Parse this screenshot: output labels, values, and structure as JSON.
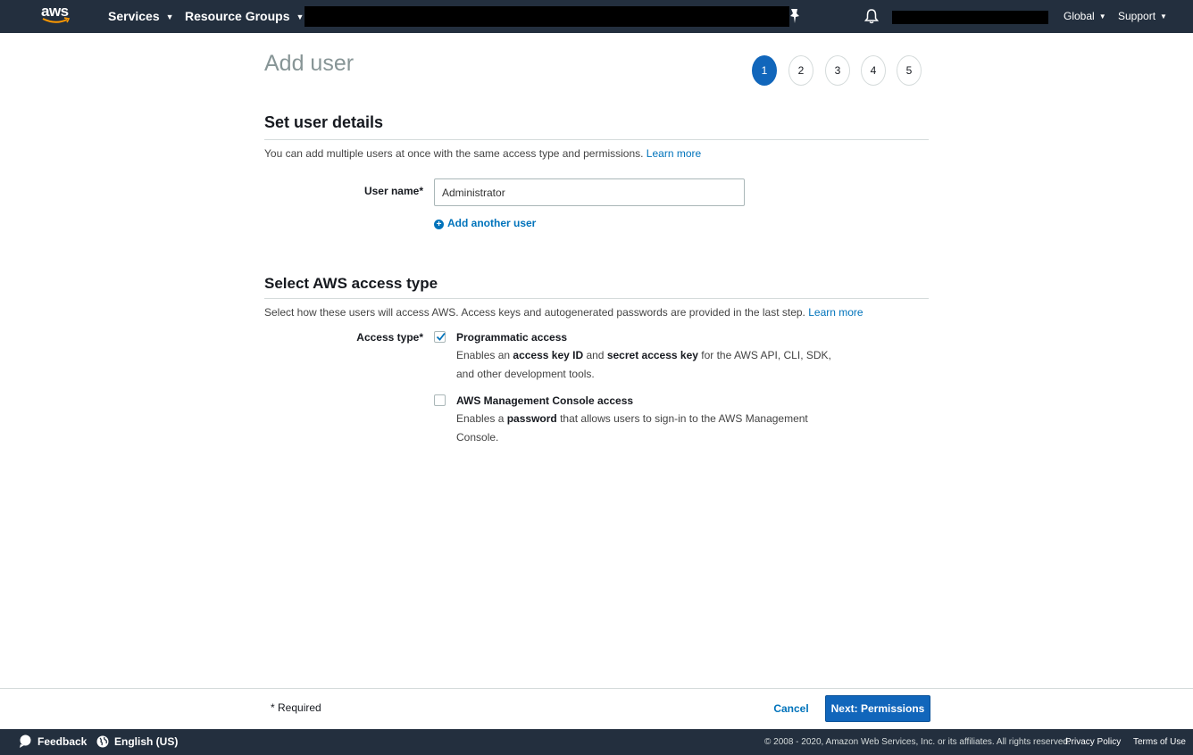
{
  "topnav": {
    "logo_text": "aws",
    "services_label": "Services",
    "resource_groups_label": "Resource Groups",
    "region_label": "Global",
    "support_label": "Support"
  },
  "page": {
    "title": "Add user",
    "steps": [
      "1",
      "2",
      "3",
      "4",
      "5"
    ],
    "active_step": 1
  },
  "user_details": {
    "heading": "Set user details",
    "description": "You can add multiple users at once with the same access type and permissions.",
    "learn_more": "Learn more",
    "user_name_label": "User name*",
    "user_name_value": "Administrator",
    "add_another_user": "Add another user"
  },
  "access_type": {
    "heading": "Select AWS access type",
    "description": "Select how these users will access AWS. Access keys and autogenerated passwords are provided in the last step.",
    "learn_more": "Learn more",
    "label": "Access type*",
    "programmatic": {
      "title": "Programmatic access",
      "checked": true,
      "desc_1": "Enables an ",
      "bold_1": "access key ID",
      "desc_2": " and ",
      "bold_2": "secret access key",
      "desc_3": " for the AWS API, CLI, SDK, and other development tools."
    },
    "console": {
      "title": "AWS Management Console access",
      "checked": false,
      "desc_1": "Enables a ",
      "bold_1": "password",
      "desc_2": " that allows users to sign-in to the AWS Management Console."
    }
  },
  "footer": {
    "required_note": "* Required",
    "cancel_label": "Cancel",
    "next_label": "Next: Permissions"
  },
  "bottombar": {
    "feedback_label": "Feedback",
    "language_label": "English (US)",
    "copyright": "© 2008 - 2020, Amazon Web Services, Inc. or its affiliates. All rights reserved.",
    "privacy_label": "Privacy Policy",
    "terms_label": "Terms of Use"
  },
  "colors": {
    "nav_bg": "#232f3e",
    "primary": "#1166bb",
    "link": "#0073bb"
  }
}
